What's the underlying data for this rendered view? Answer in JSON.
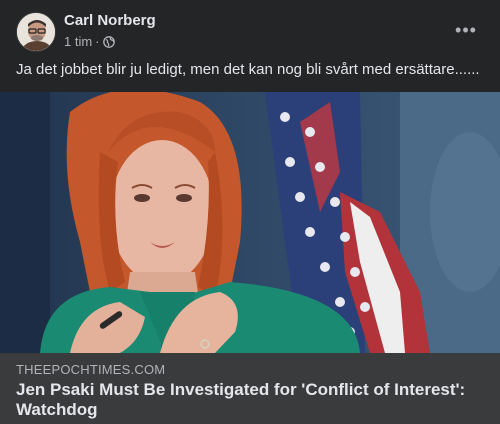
{
  "post": {
    "author": "Carl Norberg",
    "timestamp": "1 tim",
    "separator": "·",
    "privacy_icon": "globe-icon",
    "more_icon": "more-options-icon",
    "more_label": "•••",
    "message": "Ja det jobbet blir ju ledigt, men det kan nog bli svårt med ersättare......"
  },
  "link_preview": {
    "domain": "THEEPOCHTIMES.COM",
    "title": "Jen Psaki Must Be Investigated for 'Conflict of Interest': Watchdog"
  },
  "colors": {
    "background": "#242526",
    "link_box": "#3a3b3c",
    "primary_text": "#e4e6eb",
    "secondary_text": "#b0b3b8"
  }
}
